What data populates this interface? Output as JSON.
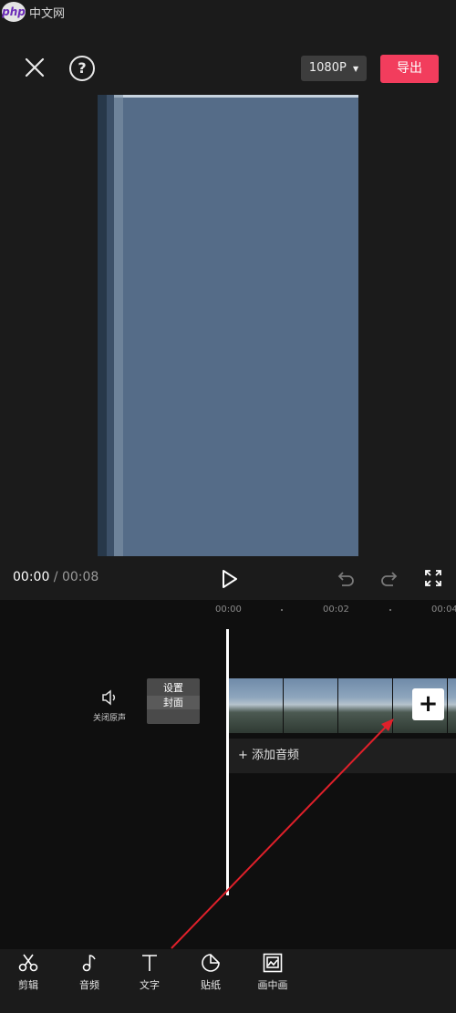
{
  "watermark": {
    "logo": "php",
    "site": "中文网"
  },
  "top_bar": {
    "resolution": "1080P",
    "export_label": "导出"
  },
  "playback": {
    "current_time": "00:00",
    "separator": " / ",
    "total_time": "00:08"
  },
  "timeline": {
    "ruler": [
      "00:00",
      "00:02",
      "00:04"
    ],
    "mute_label": "关闭原声",
    "cover_label_line1": "设置",
    "cover_label_line2": "封面",
    "add_clip_label": "+",
    "add_audio_label": "+  添加音频"
  },
  "toolbar": {
    "items": [
      {
        "label": "剪辑",
        "icon": "scissors-icon"
      },
      {
        "label": "音频",
        "icon": "music-note-icon"
      },
      {
        "label": "文字",
        "icon": "text-icon"
      },
      {
        "label": "贴纸",
        "icon": "sticker-icon"
      },
      {
        "label": "画中画",
        "icon": "picture-in-picture-icon"
      }
    ]
  },
  "colors": {
    "accent": "#f23d5d",
    "annotation": "#e0202a",
    "background": "#1b1b1b"
  }
}
